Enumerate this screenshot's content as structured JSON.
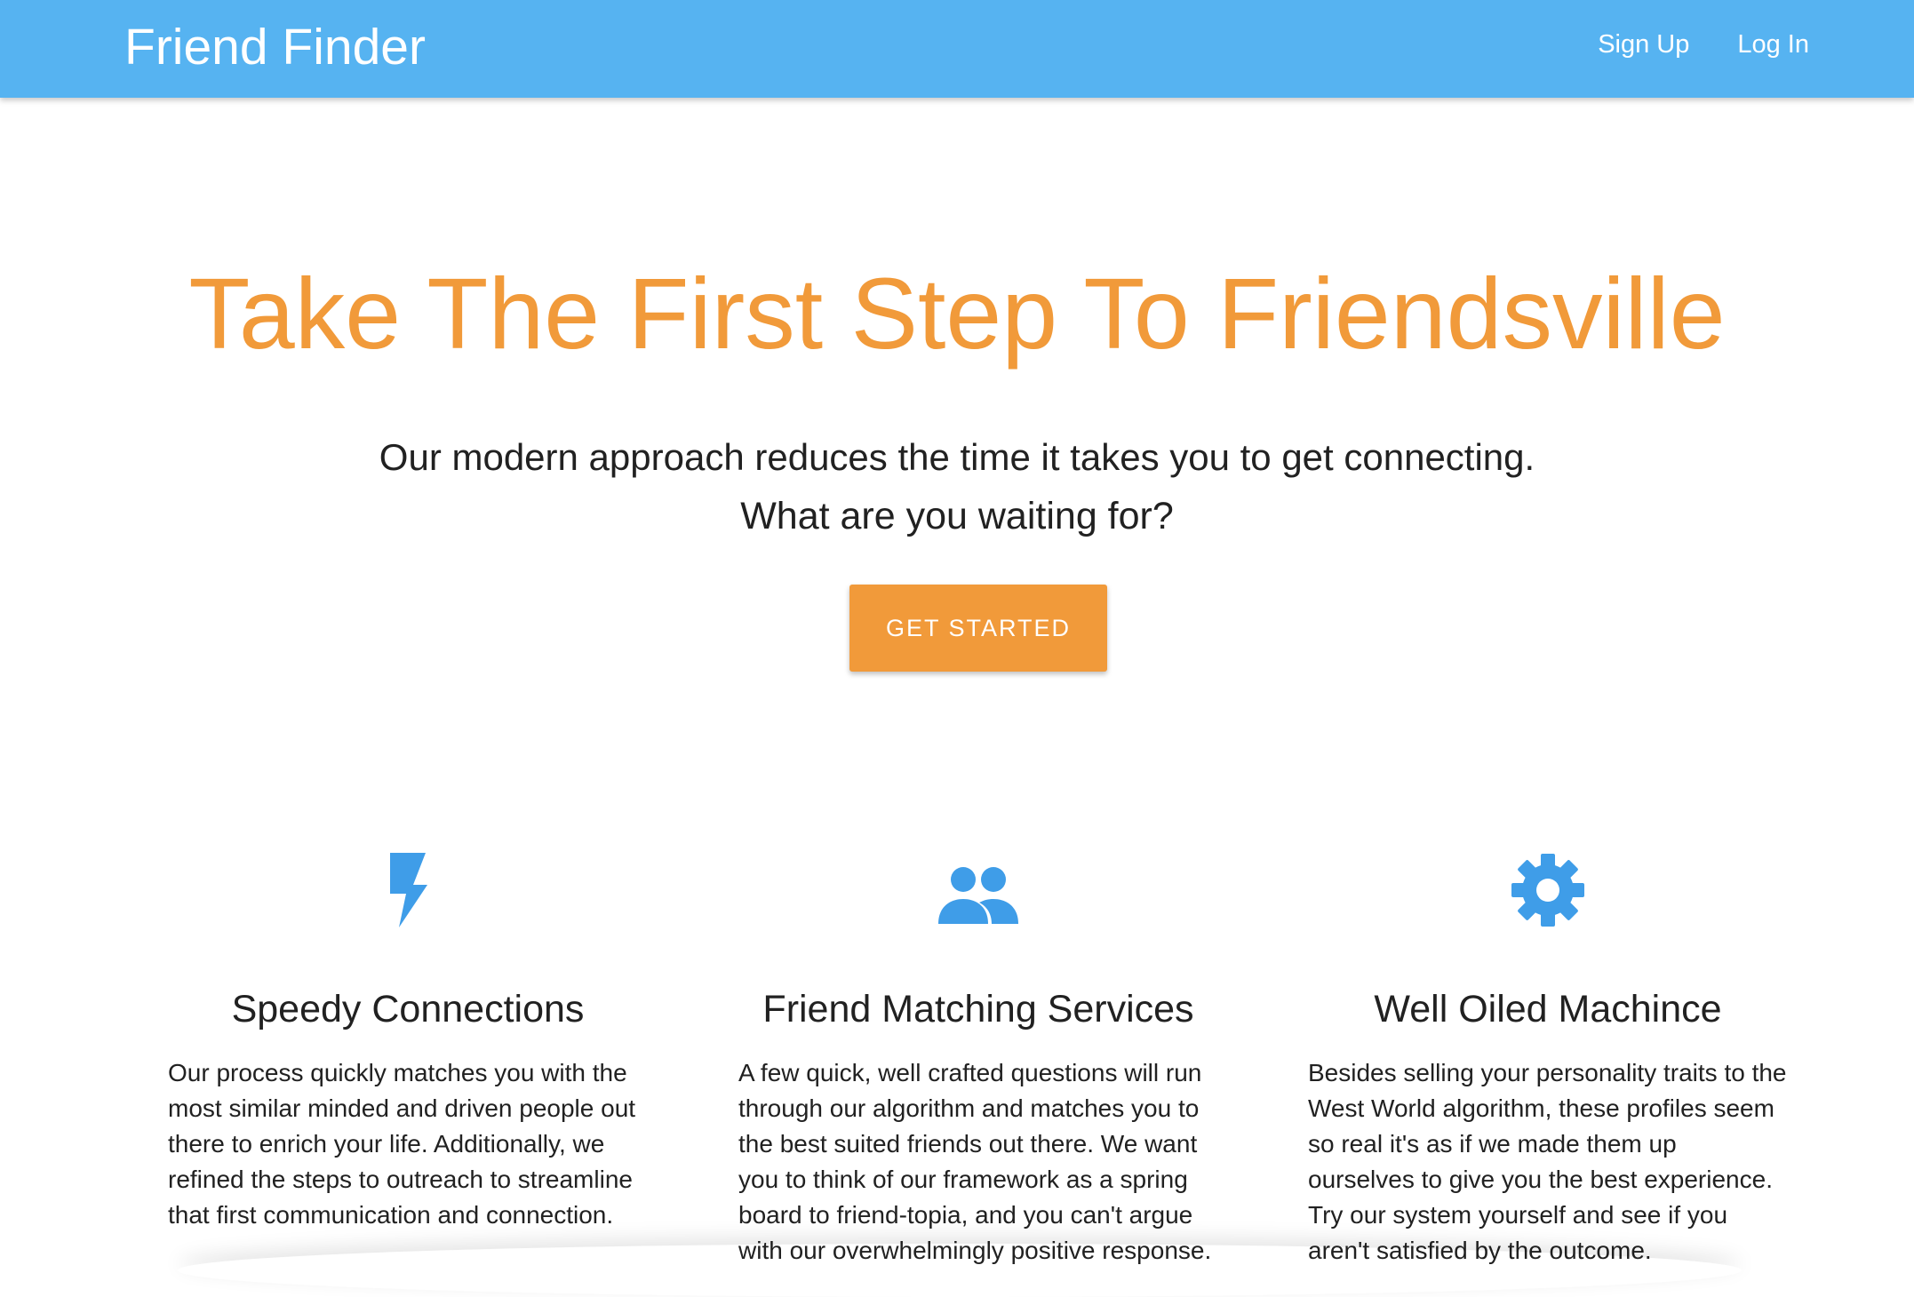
{
  "navbar": {
    "brand": "Friend Finder",
    "links": [
      {
        "label": "Sign Up"
      },
      {
        "label": "Log In"
      }
    ],
    "bg_color": "#56b3f1"
  },
  "hero": {
    "title": "Take The First Step To Friendsville",
    "subtitle": "Our modern approach reduces the time it takes you to get connecting.",
    "question": "What are you waiting for?",
    "cta_label": "GET STARTED",
    "accent_color": "#f19a3a"
  },
  "features": [
    {
      "icon": "lightning-bolt-icon",
      "title": "Speedy Connections",
      "text": "Our process quickly matches you with the most similar minded and driven people out there to enrich your life. Additionally, we refined the steps to outreach to streamline that first communication and connection."
    },
    {
      "icon": "people-icon",
      "title": "Friend Matching Services",
      "text": "A few quick, well crafted questions will run through our algorithm and matches you to the best suited friends out there. We want you to think of our framework as a spring board to friend-topia, and you can't argue with our overwhelmingly positive response."
    },
    {
      "icon": "gear-icon",
      "title": "Well Oiled Machince",
      "text": "Besides selling your personality traits to the West World algorithm, these profiles seem so real it's as if we made them up ourselves to give you the best experience. Try our system yourself and see if you aren't satisfied by the outcome."
    }
  ],
  "icon_color": "#3f9de8"
}
